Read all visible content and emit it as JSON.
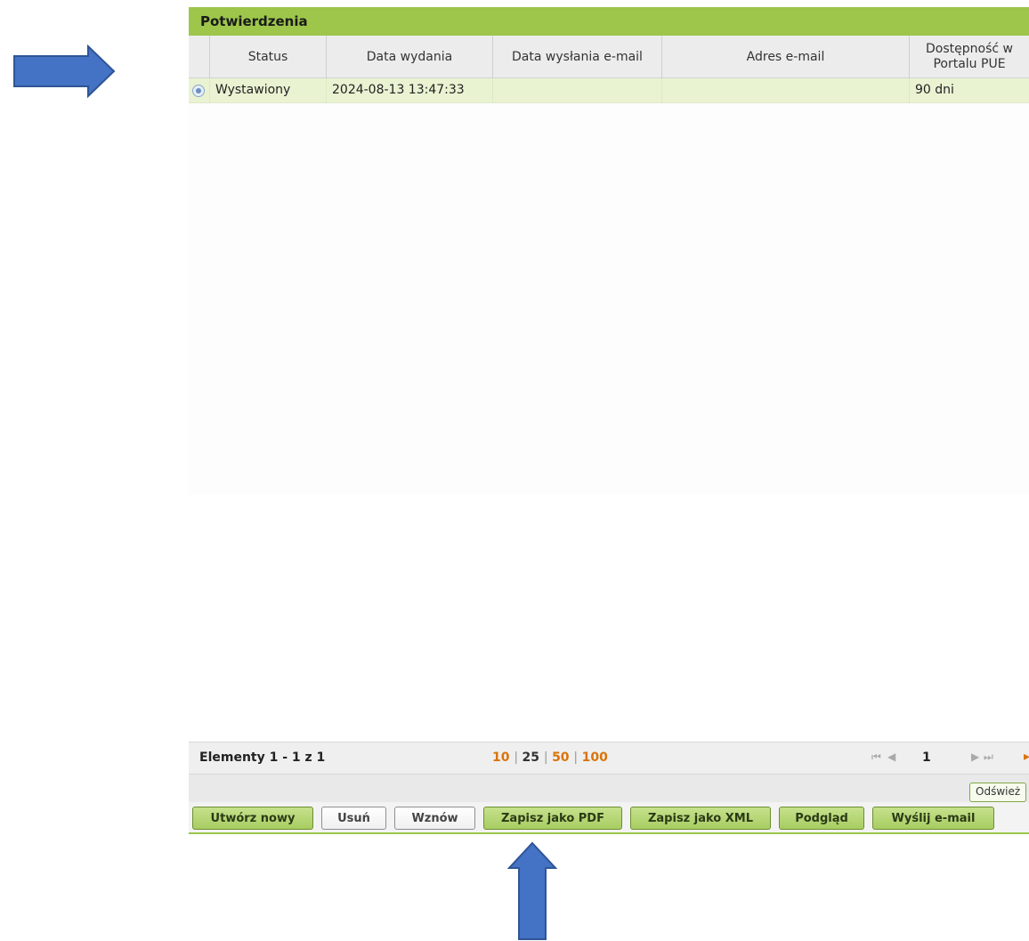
{
  "panel": {
    "title": "Potwierdzenia",
    "columns": [
      "Status",
      "Data wydania",
      "Data wysłania e-mail",
      "Adres e-mail",
      "Dostępność w Portalu PUE"
    ],
    "rows": [
      {
        "status": "Wystawiony",
        "data_wydania": "2024-08-13 13:47:33",
        "data_wyslania": "",
        "adres_email": "",
        "dostepnosc": "90 dni"
      }
    ]
  },
  "pager": {
    "label": "Elementy 1 - 1 z 1",
    "sizes": [
      "10",
      "25",
      "50",
      "100"
    ],
    "current_size": "25",
    "page": "1",
    "refresh_label": "Odśwież"
  },
  "toolbar": {
    "buttons": [
      "Utwórz nowy",
      "Usuń",
      "Wznów",
      "Zapisz jako PDF",
      "Zapisz jako XML",
      "Podgląd",
      "Wyślij e-mail"
    ]
  },
  "colors": {
    "accent_green": "#9dc64a",
    "selected_row": "#e9f3d2",
    "pager_orange": "#d9740a",
    "arrow_blue": "#4472c4"
  },
  "icons": [
    "right-arrow-annotation-icon",
    "up-arrow-annotation-icon",
    "radio-selected-icon",
    "first-page-icon",
    "prev-page-icon",
    "next-page-icon",
    "last-page-icon"
  ]
}
